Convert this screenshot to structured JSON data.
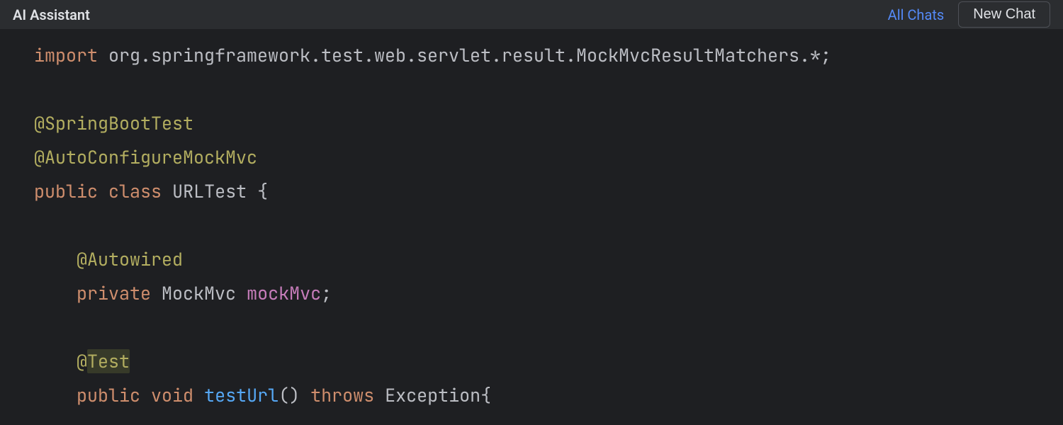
{
  "header": {
    "title": "AI Assistant",
    "all_chats": "All Chats",
    "new_chat": "New Chat"
  },
  "code": {
    "line1_kw": "import",
    "line1_rest": " org.springframework.test.web.servlet.result.MockMvcResultMatchers.*;",
    "line2": "",
    "line3_ann": "@SpringBootTest",
    "line4_ann": "@AutoConfigureMockMvc",
    "line5_kw1": "public",
    "line5_kw2": "class",
    "line5_name": "URLTest",
    "line5_brace": " {",
    "line6": "",
    "line7_indent": "    ",
    "line7_ann": "@Autowired",
    "line8_indent": "    ",
    "line8_kw": "private",
    "line8_type": "MockMvc",
    "line8_field": "mockMvc",
    "line8_semi": ";",
    "line9": "",
    "line10_indent": "    ",
    "line10_ann_at": "@",
    "line10_ann_bare": "Test",
    "line11_indent": "    ",
    "line11_kw1": "public",
    "line11_kw2": "void",
    "line11_method": "testUrl",
    "line11_paren": "()",
    "line11_kw3": "throws",
    "line11_exc": "Exception",
    "line11_brace": "{"
  }
}
